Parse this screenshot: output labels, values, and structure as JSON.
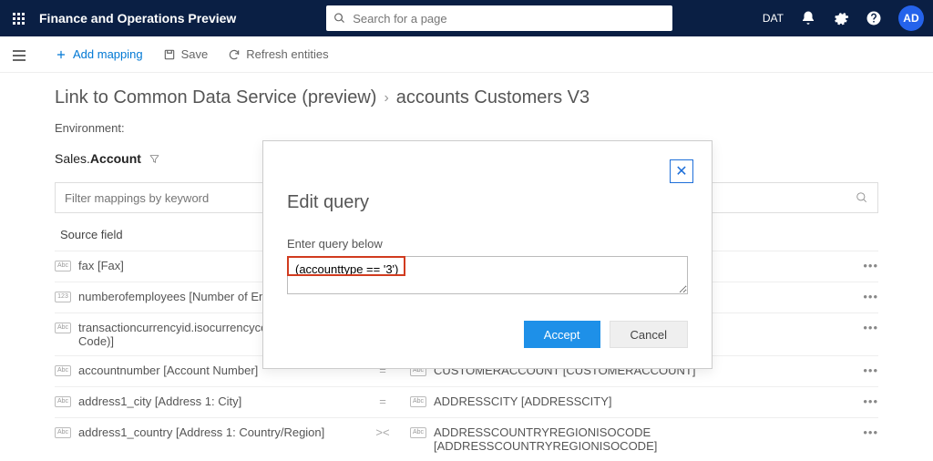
{
  "topbar": {
    "app_title": "Finance and Operations Preview",
    "search_placeholder": "Search for a page",
    "env": "DAT",
    "avatar_initials": "AD"
  },
  "commands": {
    "add_mapping": "Add mapping",
    "save": "Save",
    "refresh": "Refresh entities"
  },
  "breadcrumb": {
    "a": "Link to Common Data Service (preview)",
    "b": "accounts Customers V3"
  },
  "environment_label": "Environment:",
  "entity": {
    "label": "Sales.Account"
  },
  "filter_placeholder": "Filter mappings by keyword",
  "columns": {
    "source": "Source field"
  },
  "rows": [
    {
      "src_tag": "Abc",
      "src": "fax [Fax]",
      "op": "",
      "tgt_tag": "",
      "tgt": ""
    },
    {
      "src_tag": "123",
      "src": "numberofemployees [Number of Employees]",
      "op": "",
      "tgt_tag": "",
      "tgt": ""
    },
    {
      "src_tag": "Abc",
      "src": "transactioncurrencyid.isocurrencycode [Currency Code)]",
      "op": "",
      "tgt_tag": "",
      "tgt": ""
    },
    {
      "src_tag": "Abc",
      "src": "accountnumber [Account Number]",
      "op": "=",
      "tgt_tag": "Abc",
      "tgt": "CUSTOMERACCOUNT [CUSTOMERACCOUNT]"
    },
    {
      "src_tag": "Abc",
      "src": "address1_city [Address 1: City]",
      "op": "=",
      "tgt_tag": "Abc",
      "tgt": "ADDRESSCITY [ADDRESSCITY]"
    },
    {
      "src_tag": "Abc",
      "src": "address1_country [Address 1: Country/Region]",
      "op": "><",
      "tgt_tag": "Abc",
      "tgt": "ADDRESSCOUNTRYREGIONISOCODE [ADDRESSCOUNTRYREGIONISOCODE]"
    }
  ],
  "modal": {
    "title": "Edit query",
    "label": "Enter query below",
    "value": "(accounttype == '3')",
    "accept": "Accept",
    "cancel": "Cancel"
  }
}
